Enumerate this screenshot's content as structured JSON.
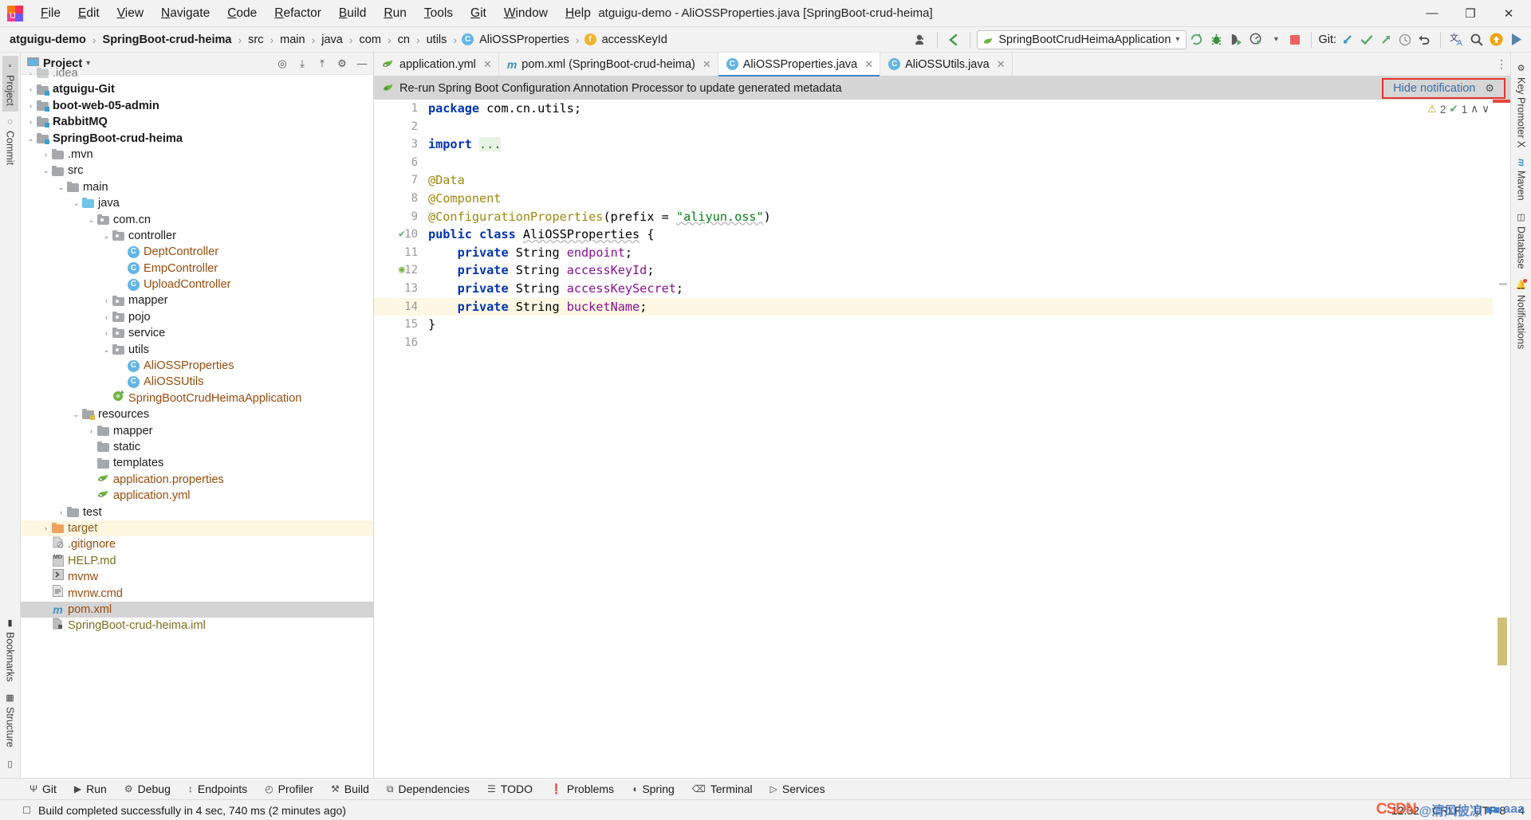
{
  "titlebar": {
    "window_title": "atguigu-demo - AliOSSProperties.java [SpringBoot-crud-heima]",
    "menus": [
      {
        "label": "File"
      },
      {
        "label": "Edit"
      },
      {
        "label": "View"
      },
      {
        "label": "Navigate"
      },
      {
        "label": "Code"
      },
      {
        "label": "Refactor"
      },
      {
        "label": "Build"
      },
      {
        "label": "Run"
      },
      {
        "label": "Tools"
      },
      {
        "label": "Git"
      },
      {
        "label": "Window"
      },
      {
        "label": "Help"
      }
    ],
    "window_controls": {
      "minimize": "—",
      "maximize": "❐",
      "close": "✕"
    }
  },
  "breadcrumb": {
    "items": [
      {
        "label": "atguigu-demo",
        "bold": true,
        "icon": ""
      },
      {
        "label": "SpringBoot-crud-heima",
        "bold": true,
        "icon": ""
      },
      {
        "label": "src",
        "bold": false,
        "icon": ""
      },
      {
        "label": "main",
        "bold": false,
        "icon": ""
      },
      {
        "label": "java",
        "bold": false,
        "icon": ""
      },
      {
        "label": "com",
        "bold": false,
        "icon": ""
      },
      {
        "label": "cn",
        "bold": false,
        "icon": ""
      },
      {
        "label": "utils",
        "bold": false,
        "icon": ""
      },
      {
        "label": "AliOSSProperties",
        "bold": false,
        "icon": "class-icon"
      },
      {
        "label": "accessKeyId",
        "bold": false,
        "icon": "field-icon"
      }
    ],
    "separator": "›"
  },
  "toolbar": {
    "run_config": "SpringBootCrudHeimaApplication",
    "run_config_dropdown": "▾",
    "git_label": "Git:",
    "buttons": [
      {
        "name": "user-avatar-button",
        "glyph": "👤"
      },
      {
        "name": "back-arrow-button",
        "glyph": "↖"
      },
      {
        "name": "rerun-button",
        "glyph": "↻"
      },
      {
        "name": "debug-button",
        "glyph": "🐞"
      },
      {
        "name": "run-with-coverage-button",
        "glyph": "▶"
      },
      {
        "name": "profiler-button",
        "glyph": "◴"
      },
      {
        "name": "stop-button",
        "glyph": "■"
      },
      {
        "name": "git-update-button",
        "glyph": "↙"
      },
      {
        "name": "git-commit-button",
        "glyph": "✓"
      },
      {
        "name": "git-push-button",
        "glyph": "↗"
      },
      {
        "name": "git-history-button",
        "glyph": "◷"
      },
      {
        "name": "git-rollback-button",
        "glyph": "↶"
      },
      {
        "name": "translate-button",
        "glyph": "文"
      },
      {
        "name": "search-everywhere-button",
        "glyph": "🔍"
      },
      {
        "name": "update-badge-button",
        "glyph": "↑"
      },
      {
        "name": "ide-assistant-button",
        "glyph": "▶"
      }
    ]
  },
  "left_rail": {
    "top_items": [
      {
        "label": "Project",
        "icon": "project-icon",
        "active": true
      },
      {
        "label": "Commit",
        "icon": "commit-icon",
        "active": false
      }
    ],
    "bottom_items": [
      {
        "label": "Bookmarks",
        "icon": "bookmark-icon",
        "active": false
      },
      {
        "label": "Structure",
        "icon": "structure-icon",
        "active": false
      }
    ],
    "layout_button": "❐"
  },
  "right_rail": {
    "items": [
      {
        "label": "Key Promoter X",
        "icon": "key-promoter-icon"
      },
      {
        "label": "Maven",
        "icon": "maven-icon"
      },
      {
        "label": "Database",
        "icon": "database-icon"
      },
      {
        "label": "Notifications",
        "icon": "bell-icon"
      }
    ]
  },
  "project_panel": {
    "title": "Project",
    "title_dropdown": "▾",
    "header_buttons": [
      {
        "name": "scroll-from-source-icon",
        "glyph": "◎"
      },
      {
        "name": "expand-all-icon",
        "glyph": "⤓"
      },
      {
        "name": "collapse-all-icon",
        "glyph": "⤒"
      },
      {
        "name": "settings-gear-icon",
        "glyph": "⚙"
      },
      {
        "name": "hide-panel-icon",
        "glyph": "—"
      }
    ],
    "tree": [
      {
        "label": ".idea",
        "indent": 1,
        "twisty": "›",
        "icon": "folder",
        "style": "plain",
        "state": "cut"
      },
      {
        "label": "atguigu-Git",
        "indent": 1,
        "twisty": "›",
        "icon": "module",
        "style": "bold"
      },
      {
        "label": "boot-web-05-admin",
        "indent": 1,
        "twisty": "›",
        "icon": "module",
        "style": "bold"
      },
      {
        "label": "RabbitMQ",
        "indent": 1,
        "twisty": "›",
        "icon": "module",
        "style": "bold"
      },
      {
        "label": "SpringBoot-crud-heima",
        "indent": 1,
        "twisty": "⌄",
        "icon": "module",
        "style": "bold"
      },
      {
        "label": ".mvn",
        "indent": 2,
        "twisty": "›",
        "icon": "folder",
        "style": "plain"
      },
      {
        "label": "src",
        "indent": 2,
        "twisty": "⌄",
        "icon": "folder",
        "style": "plain"
      },
      {
        "label": "main",
        "indent": 3,
        "twisty": "⌄",
        "icon": "folder",
        "style": "plain"
      },
      {
        "label": "java",
        "indent": 4,
        "twisty": "⌄",
        "icon": "folder-blue",
        "style": "plain"
      },
      {
        "label": "com.cn",
        "indent": 5,
        "twisty": "⌄",
        "icon": "package",
        "style": "plain"
      },
      {
        "label": "controller",
        "indent": 6,
        "twisty": "⌄",
        "icon": "package",
        "style": "plain"
      },
      {
        "label": "DeptController",
        "indent": 7,
        "twisty": "",
        "icon": "class",
        "style": "orange"
      },
      {
        "label": "EmpController",
        "indent": 7,
        "twisty": "",
        "icon": "class",
        "style": "orange"
      },
      {
        "label": "UploadController",
        "indent": 7,
        "twisty": "",
        "icon": "class",
        "style": "orange"
      },
      {
        "label": "mapper",
        "indent": 6,
        "twisty": "›",
        "icon": "package",
        "style": "plain"
      },
      {
        "label": "pojo",
        "indent": 6,
        "twisty": "›",
        "icon": "package",
        "style": "plain"
      },
      {
        "label": "service",
        "indent": 6,
        "twisty": "›",
        "icon": "package",
        "style": "plain"
      },
      {
        "label": "utils",
        "indent": 6,
        "twisty": "⌄",
        "icon": "package",
        "style": "plain"
      },
      {
        "label": "AliOSSProperties",
        "indent": 7,
        "twisty": "",
        "icon": "class",
        "style": "orange"
      },
      {
        "label": "AliOSSUtils",
        "indent": 7,
        "twisty": "",
        "icon": "class",
        "style": "orange"
      },
      {
        "label": "SpringBootCrudHeimaApplication",
        "indent": 6,
        "twisty": "",
        "icon": "spring-run",
        "style": "orange"
      },
      {
        "label": "resources",
        "indent": 4,
        "twisty": "⌄",
        "icon": "resources",
        "style": "plain"
      },
      {
        "label": "mapper",
        "indent": 5,
        "twisty": "›",
        "icon": "folder",
        "style": "plain"
      },
      {
        "label": "static",
        "indent": 5,
        "twisty": "",
        "icon": "folder",
        "style": "plain"
      },
      {
        "label": "templates",
        "indent": 5,
        "twisty": "",
        "icon": "folder",
        "style": "plain"
      },
      {
        "label": "application.properties",
        "indent": 5,
        "twisty": "",
        "icon": "spring-file",
        "style": "orange"
      },
      {
        "label": "application.yml",
        "indent": 5,
        "twisty": "",
        "icon": "spring-file",
        "style": "orange"
      },
      {
        "label": "test",
        "indent": 3,
        "twisty": "›",
        "icon": "folder",
        "style": "plain"
      },
      {
        "label": "target",
        "indent": 2,
        "twisty": "›",
        "icon": "folder-orange",
        "style": "brown",
        "row": "highlight"
      },
      {
        "label": ".gitignore",
        "indent": 2,
        "twisty": "",
        "icon": "ignore-file",
        "style": "orange"
      },
      {
        "label": "HELP.md",
        "indent": 2,
        "twisty": "",
        "icon": "md-file",
        "style": "olive"
      },
      {
        "label": "mvnw",
        "indent": 2,
        "twisty": "",
        "icon": "script-file",
        "style": "orange"
      },
      {
        "label": "mvnw.cmd",
        "indent": 2,
        "twisty": "",
        "icon": "text-file",
        "style": "orange"
      },
      {
        "label": "pom.xml",
        "indent": 2,
        "twisty": "",
        "icon": "maven-file",
        "style": "orange",
        "row": "selected"
      },
      {
        "label": "SpringBoot-crud-heima.iml",
        "indent": 2,
        "twisty": "",
        "icon": "iml-file",
        "style": "olive"
      }
    ]
  },
  "editor": {
    "tabs": [
      {
        "label": "application.yml",
        "icon": "spring-file-icon",
        "active": false,
        "close": "✕"
      },
      {
        "label": "pom.xml (SpringBoot-crud-heima)",
        "icon": "maven-file-icon",
        "active": false,
        "close": "✕"
      },
      {
        "label": "AliOSSProperties.java",
        "icon": "class-icon",
        "active": true,
        "close": "✕"
      },
      {
        "label": "AliOSSUtils.java",
        "icon": "class-icon",
        "active": false,
        "close": "✕"
      }
    ],
    "tabs_overflow": "⋮",
    "notification": {
      "icon": "spring-leaf-icon",
      "text": "Re-run Spring Boot Configuration Annotation Processor to update generated metadata",
      "action_label": "Hide notification",
      "settings_glyph": "⚙",
      "highlight_color": "#e8322c"
    },
    "inspection_widget": {
      "warning_glyph": "⚠",
      "warning_count": "2",
      "ok_glyph": "✔",
      "ok_count": "1",
      "up_glyph": "∧",
      "down_glyph": "∨"
    },
    "line_numbers": [
      "1",
      "2",
      "3",
      "6",
      "7",
      "8",
      "9",
      "10",
      "11",
      "12",
      "13",
      "14",
      "15",
      "16"
    ],
    "gutter_marks": [
      {
        "line_index": 7,
        "glyph": "✔",
        "name": "bean-gutter-icon"
      },
      {
        "line_index": 9,
        "glyph": "◉",
        "name": "spring-bean-gutter-icon"
      }
    ],
    "highlighted_line_index": 11,
    "code_lines": [
      {
        "tokens": [
          {
            "t": "package ",
            "c": "kw"
          },
          {
            "t": "com.cn.utils;",
            "c": "pnct"
          }
        ]
      },
      {
        "tokens": []
      },
      {
        "tokens": [
          {
            "t": "import ",
            "c": "kw"
          },
          {
            "t": "...",
            "c": "fold"
          }
        ],
        "fold": "⊞"
      },
      {
        "tokens": []
      },
      {
        "tokens": [
          {
            "t": "@Data",
            "c": "ann"
          }
        ],
        "fold": "▽"
      },
      {
        "tokens": [
          {
            "t": "@Component",
            "c": "ann"
          }
        ]
      },
      {
        "tokens": [
          {
            "t": "@ConfigurationProperties",
            "c": "ann"
          },
          {
            "t": "(",
            "c": "pnct"
          },
          {
            "t": "prefix",
            "c": "pnct"
          },
          {
            "t": " = ",
            "c": "pnct"
          },
          {
            "t": "\"aliyun.oss\"",
            "c": "str"
          },
          {
            "t": ")",
            "c": "pnct"
          }
        ],
        "fold": "⊟"
      },
      {
        "tokens": [
          {
            "t": "public ",
            "c": "kw"
          },
          {
            "t": "class ",
            "c": "kw"
          },
          {
            "t": "AliOSSProperties",
            "c": "cls-squig"
          },
          {
            "t": " {",
            "c": "pnct"
          }
        ]
      },
      {
        "tokens": [
          {
            "t": "    ",
            "c": "pnct"
          },
          {
            "t": "private ",
            "c": "kw"
          },
          {
            "t": "String ",
            "c": "pnct"
          },
          {
            "t": "endpoint",
            "c": "fld"
          },
          {
            "t": ";",
            "c": "pnct"
          }
        ]
      },
      {
        "tokens": [
          {
            "t": "    ",
            "c": "pnct"
          },
          {
            "t": "private ",
            "c": "kw"
          },
          {
            "t": "String ",
            "c": "pnct"
          },
          {
            "t": "accessKeyId",
            "c": "fld"
          },
          {
            "t": ";",
            "c": "pnct"
          }
        ]
      },
      {
        "tokens": [
          {
            "t": "    ",
            "c": "pnct"
          },
          {
            "t": "private ",
            "c": "kw"
          },
          {
            "t": "String ",
            "c": "pnct"
          },
          {
            "t": "accessKeySecret",
            "c": "fld"
          },
          {
            "t": ";",
            "c": "pnct"
          }
        ]
      },
      {
        "tokens": [
          {
            "t": "    ",
            "c": "pnct"
          },
          {
            "t": "private ",
            "c": "kw"
          },
          {
            "t": "String ",
            "c": "pnct"
          },
          {
            "t": "bucketName",
            "c": "fld"
          },
          {
            "t": ";",
            "c": "pnct"
          }
        ]
      },
      {
        "tokens": [
          {
            "t": "}",
            "c": "pnct"
          }
        ]
      },
      {
        "tokens": []
      }
    ]
  },
  "tool_windows": [
    {
      "label": "Git",
      "icon": "git-branch-icon"
    },
    {
      "label": "Run",
      "icon": "run-icon"
    },
    {
      "label": "Debug",
      "icon": "debug-icon"
    },
    {
      "label": "Endpoints",
      "icon": "endpoints-icon"
    },
    {
      "label": "Profiler",
      "icon": "profiler-icon"
    },
    {
      "label": "Build",
      "icon": "build-hammer-icon"
    },
    {
      "label": "Dependencies",
      "icon": "dependencies-icon"
    },
    {
      "label": "TODO",
      "icon": "todo-icon"
    },
    {
      "label": "Problems",
      "icon": "problems-icon"
    },
    {
      "label": "Spring",
      "icon": "spring-icon"
    },
    {
      "label": "Terminal",
      "icon": "terminal-icon"
    },
    {
      "label": "Services",
      "icon": "services-icon"
    }
  ],
  "statusbar": {
    "message": "Build completed successfully in 4 sec, 740 ms (2 minutes ago)",
    "message_icon": "build-status-icon",
    "caret_position": "12:32",
    "line_separator": "CRLF",
    "encoding": "UTF-8",
    "indent": "4",
    "watermark": {
      "brand": "CSDN",
      "handle": "@清风彼凉",
      "suffix": "aaa"
    }
  }
}
